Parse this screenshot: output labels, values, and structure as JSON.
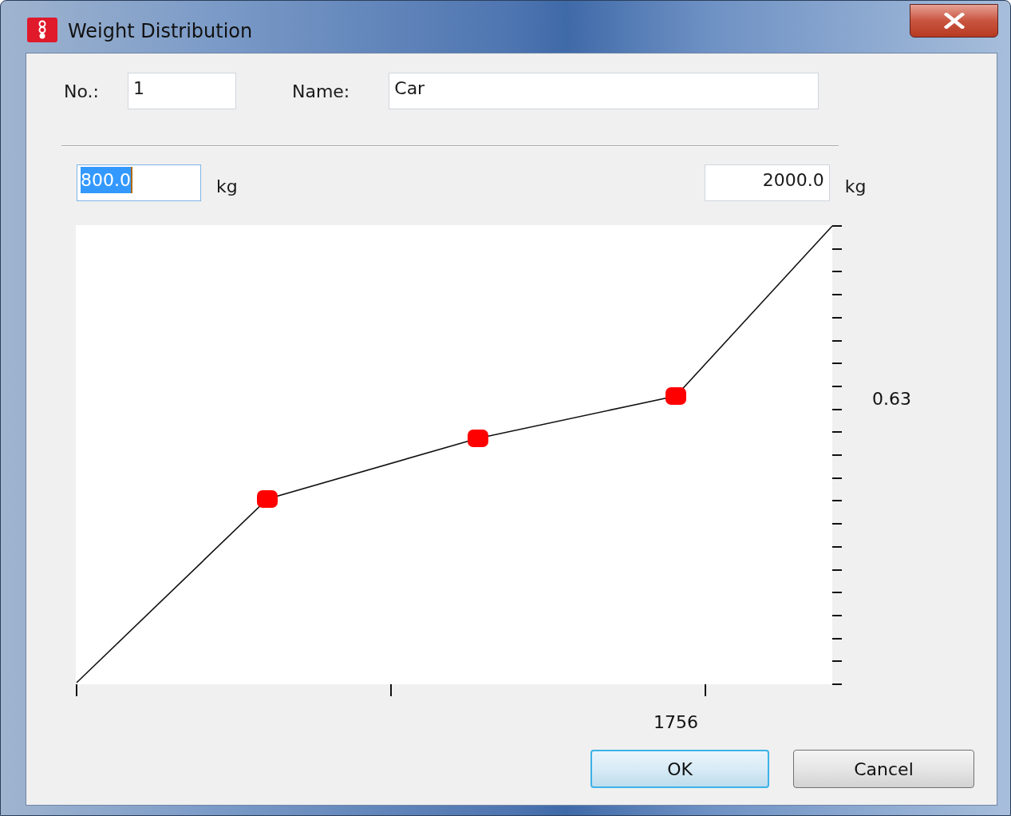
{
  "window": {
    "title": "Weight Distribution"
  },
  "fields": {
    "no_label": "No.:",
    "no_value": "1",
    "name_label": "Name:",
    "name_value": "Car"
  },
  "range": {
    "min_value": "800.0",
    "min_selected": true,
    "min_unit": "kg",
    "max_value": "2000.0",
    "max_unit": "kg"
  },
  "chart": {
    "y_readout": "0.63",
    "x_readout": "1756"
  },
  "buttons": [
    {
      "label": "OK",
      "default": true
    },
    {
      "label": "Cancel",
      "default": false
    }
  ]
}
